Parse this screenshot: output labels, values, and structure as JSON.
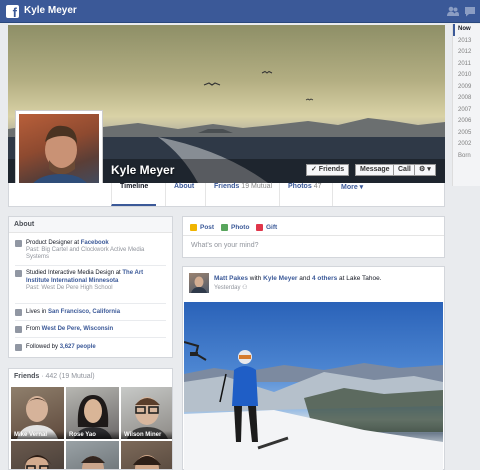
{
  "topbar": {
    "user_name": "Kyle Meyer",
    "logo_letter": "f",
    "icons": [
      "friend-requests-icon",
      "messages-icon"
    ]
  },
  "profile": {
    "name": "Kyle Meyer"
  },
  "cover_buttons": {
    "friends": "✓ Friends",
    "message": "Message",
    "call": "Call",
    "settings": "⚙ ▾"
  },
  "nav_tabs": [
    {
      "label": "Timeline",
      "sub": ""
    },
    {
      "label": "About",
      "sub": ""
    },
    {
      "label": "Friends",
      "sub": "19 Mutual"
    },
    {
      "label": "Photos",
      "sub": "47"
    },
    {
      "label": "More ▾",
      "sub": ""
    }
  ],
  "years": [
    "Now",
    "2013",
    "2012",
    "2011",
    "2010",
    "2009",
    "2008",
    "2007",
    "2006",
    "2005",
    "2002",
    "Born"
  ],
  "about": {
    "title": "About",
    "work_prefix": "Product Designer at ",
    "work_link": "Facebook",
    "work_past": "Past: Big Cartel and Clockwork Active Media Systems",
    "edu_prefix": "Studied Interactive Media Design at ",
    "edu_link": "The Art Institute International Minnesota",
    "edu_past": "Past: West De Pere High School",
    "lives_prefix": "Lives in ",
    "lives_link": "San Francisco, California",
    "from_prefix": "From ",
    "from_link": "West De Pere, Wisconsin",
    "followed_prefix": "Followed by ",
    "followed_link": "3,627 people"
  },
  "friends": {
    "title": "Friends",
    "count_text": " · 442 (19 Mutual)",
    "tiles": [
      {
        "name": "Mike Vernal"
      },
      {
        "name": "Rose Yao"
      },
      {
        "name": "Wilson Miner"
      },
      {
        "name": ""
      },
      {
        "name": ""
      },
      {
        "name": ""
      }
    ]
  },
  "composer": {
    "post": "Post",
    "photo": "Photo",
    "gift": "Gift",
    "placeholder": "What's on your mind?"
  },
  "post": {
    "author": "Matt Pakes",
    "with_text": " with ",
    "tagged": "Kyle Meyer",
    "and_text": " and ",
    "others": "4 others",
    "place_text": " at Lake Tahoe.",
    "time": "Yesterday"
  },
  "colors": {
    "brand": "#3b5998",
    "link": "#3b5998",
    "page_bg": "#e9ebee"
  }
}
